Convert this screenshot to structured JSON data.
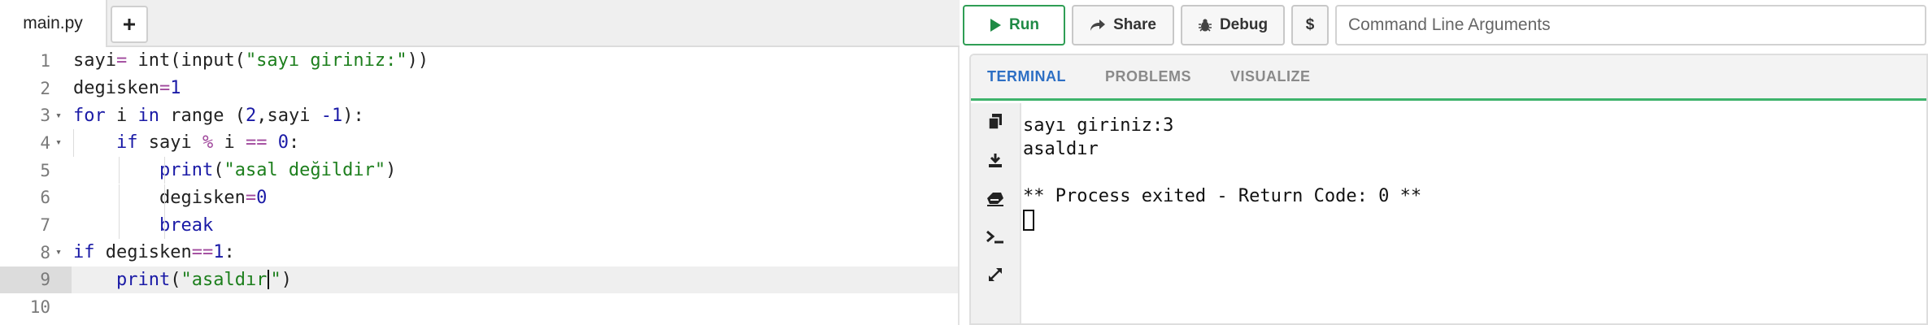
{
  "editor": {
    "file_tab": "main.py",
    "add_tab_icon": "plus-icon",
    "lines": [
      {
        "n": "1"
      },
      {
        "n": "2"
      },
      {
        "n": "3"
      },
      {
        "n": "4"
      },
      {
        "n": "5"
      },
      {
        "n": "6"
      },
      {
        "n": "7"
      },
      {
        "n": "8"
      },
      {
        "n": "9"
      },
      {
        "n": "10"
      }
    ],
    "tokens": {
      "l1a": "sayi",
      "l1b": "=",
      "l1c": " int(input(",
      "l1d": "\"sayı giriniz:\"",
      "l1e": "))",
      "l2a": "degisken",
      "l2b": "=",
      "l2c": "1",
      "l3a": "for",
      "l3b": " i ",
      "l3c": "in",
      "l3d": " range (",
      "l3e": "2",
      "l3f": ",sayi ",
      "l3g": "-1",
      "l3h": "):",
      "l4a": "    ",
      "l4b": "if",
      "l4c": " sayi ",
      "l4d": "%",
      "l4e": " i ",
      "l4f": "==",
      "l4g": " ",
      "l4h": "0",
      "l4i": ":",
      "l5a": "        ",
      "l5b": "print",
      "l5c": "(",
      "l5d": "\"asal değildir\"",
      "l5e": ")",
      "l6a": "        degisken",
      "l6b": "=",
      "l6c": "0",
      "l7a": "        ",
      "l7b": "break",
      "l8a": "if",
      "l8b": " degisken",
      "l8c": "==",
      "l8d": "1",
      "l8e": ":",
      "l9a": "    ",
      "l9b": "print",
      "l9c": "(",
      "l9d": "\"asaldır",
      "l9e": "\"",
      "l9f": ")"
    }
  },
  "toolbar": {
    "run": "Run",
    "share": "Share",
    "debug": "Debug",
    "dollar": "$",
    "args_placeholder": "Command Line Arguments"
  },
  "output": {
    "tabs": [
      "TERMINAL",
      "PROBLEMS",
      "VISUALIZE"
    ],
    "active_tab": "TERMINAL",
    "side_icons": [
      "copy-icon",
      "download-icon",
      "eraser-icon",
      "terminal-icon",
      "expand-icon"
    ],
    "terminal_lines": [
      "sayı giriniz:3",
      "asaldır",
      "",
      "** Process exited - Return Code: 0 **"
    ]
  },
  "colors": {
    "keyword": "#1a1aa6",
    "string": "#1d7f1d",
    "operator": "#a0489c",
    "run_green": "#1f8a45",
    "active_tab_blue": "#2d6fc4",
    "tab_underline": "#3db36b"
  }
}
